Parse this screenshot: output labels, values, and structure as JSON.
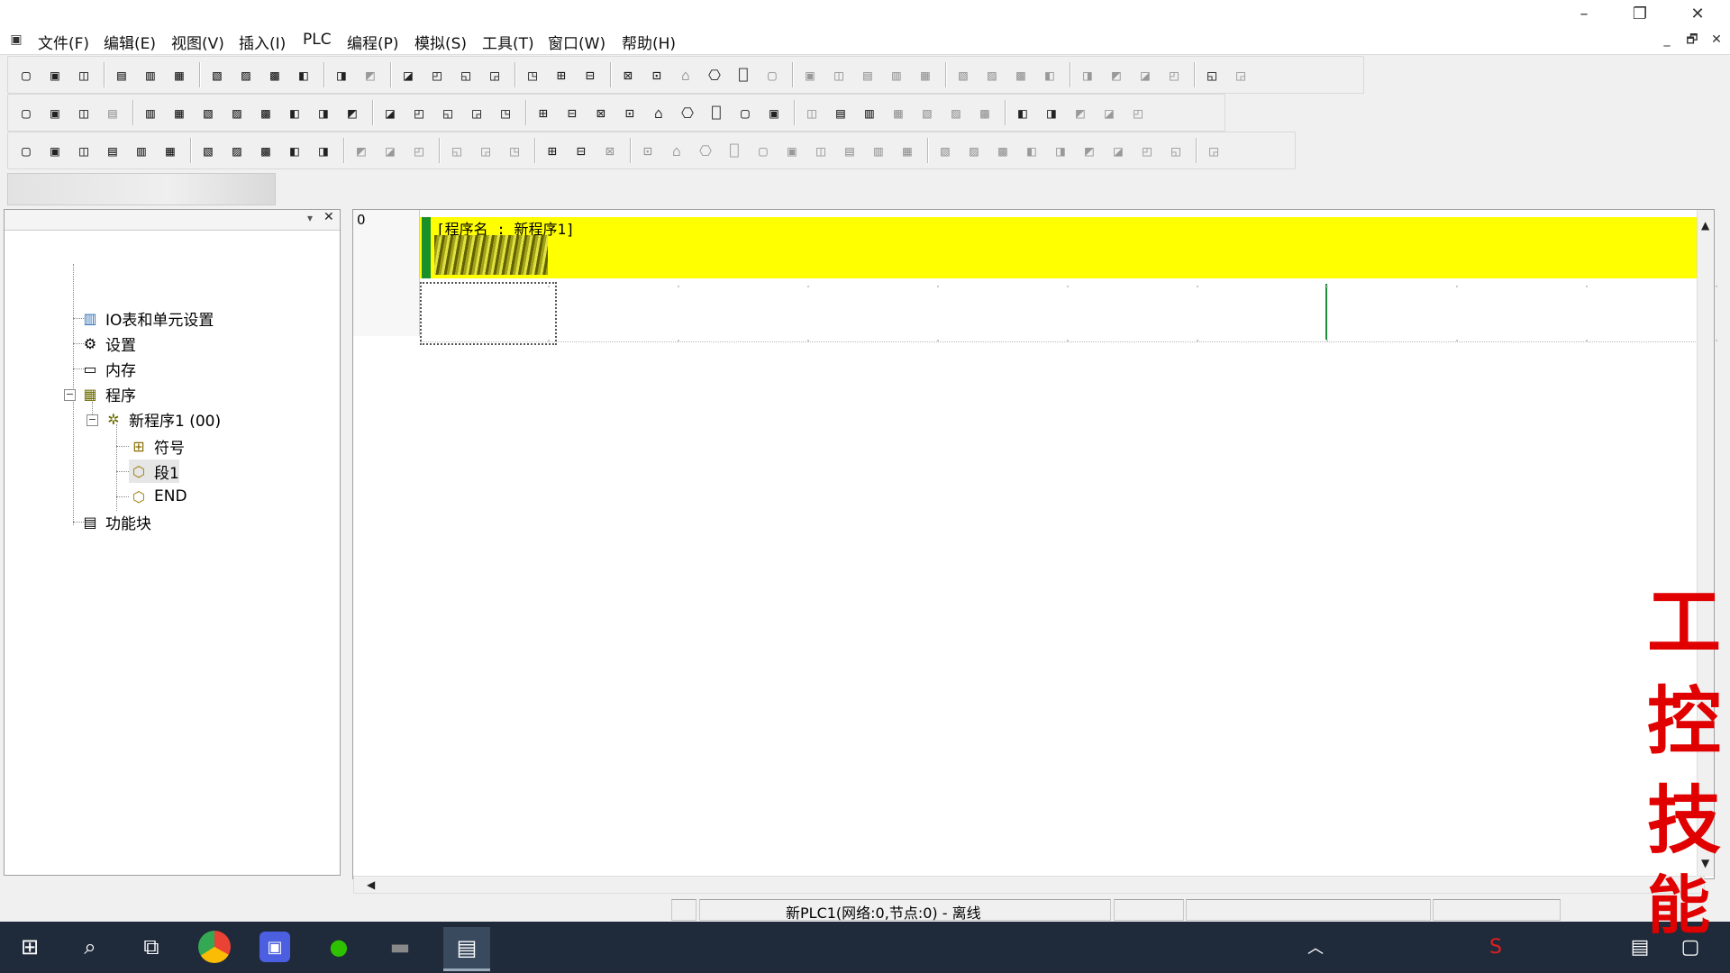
{
  "window": {
    "title": "",
    "controls": {
      "minimize": "–",
      "restore": "❐",
      "close": "✕"
    },
    "mdi_controls": {
      "minimize": "_",
      "restore": "🗗",
      "close": "✕"
    }
  },
  "menubar": {
    "items": [
      "文件(F)",
      "编辑(E)",
      "视图(V)",
      "插入(I)",
      "PLC",
      "编程(P)",
      "模拟(S)",
      "工具(T)",
      "窗口(W)",
      "帮助(H)"
    ]
  },
  "toolbar1": {
    "icons": [
      "new-icon",
      "open-icon",
      "save-icon",
      "print-preview-icon",
      "print-icon",
      "preview-icon",
      "cut-icon",
      "copy-icon",
      "paste-icon",
      "paste-special-icon",
      "undo-icon",
      "redo-icon",
      "find-icon",
      "replace-icon",
      "find-address-icon",
      "cross-ref-icon",
      "info-icon",
      "help-icon",
      "context-help-icon",
      "warning-icon",
      "compile-icon",
      "find-binoculars-icon",
      "program-check-icon",
      "monitor-icon",
      "online-edit-icon",
      "pause-icon",
      "transfer-icon",
      "transfer-to-icon",
      "transfer-from-icon",
      "compare-icon",
      "download-icon",
      "upload-icon",
      "memory-1-icon",
      "memory-2-icon",
      "memory-3-icon",
      "memory-4-icon",
      "force-on-icon",
      "force-off-icon",
      "io-table-icon",
      "setting-icon"
    ]
  },
  "toolbar2": {
    "icons": [
      "zoom-small-icon",
      "zoom-in-icon",
      "zoom-out-icon",
      "zoom-fit-icon",
      "grid-icon",
      "comment-icon",
      "list-icon",
      "rung-icon",
      "symbol-table-icon",
      "tree-icon",
      "memory-view-icon",
      "ct-icon",
      "select-icon",
      "contact-no-icon",
      "contact-nc-icon",
      "contact-or-icon",
      "contact-or-nc-icon",
      "vertical-line-icon",
      "horizontal-line-icon",
      "coil-icon",
      "coil-nc-icon",
      "instruction-icon",
      "instruction2-icon",
      "branch-icon",
      "corner-icon",
      "delete-icon",
      "network-icon",
      "stack-icon",
      "calendar-icon",
      "bit-icon",
      "bit2-icon",
      "bit3-icon",
      "bit4-icon",
      "table-icon",
      "grid-view-icon",
      "view1-icon",
      "view2-icon",
      "view3-icon"
    ]
  },
  "toolbar3": {
    "icons": [
      "window-icon",
      "window2-icon",
      "window3-icon",
      "window4-icon",
      "window5-icon",
      "properties-icon",
      "link-icon",
      "symbol-icon",
      "book-icon",
      "frame-icon",
      "calc-icon",
      "counter10-icon",
      "counter10b-icon",
      "counter16-icon",
      "step-in-icon",
      "step-out-icon",
      "sim-icon",
      "sim-online-icon",
      "sim-monitor-icon",
      "sim-list-icon",
      "hand-icon",
      "hand2-icon",
      "play-icon",
      "stop-icon",
      "pause2-icon",
      "step-forward-icon",
      "step-into-icon",
      "step-over-icon",
      "fast-forward-icon",
      "end-icon",
      "segment-icon",
      "segment2-icon",
      "segment3-icon",
      "segment4-icon",
      "divider1-icon",
      "divider2-icon",
      "divider3-icon",
      "divider4-icon",
      "divider5-icon",
      "return-icon"
    ]
  },
  "tree": {
    "items": [
      {
        "label": "IO表和单元设置",
        "icon": "io-table-icon",
        "level": 1
      },
      {
        "label": "设置",
        "icon": "settings-icon",
        "level": 1
      },
      {
        "label": "内存",
        "icon": "memory-icon",
        "level": 1
      },
      {
        "label": "程序",
        "icon": "program-icon",
        "level": 1,
        "expander": "−"
      },
      {
        "label": "新程序1 (00)",
        "icon": "program-node-icon",
        "level": 2,
        "expander": "−"
      },
      {
        "label": "符号",
        "icon": "symbol-icon",
        "level": 3
      },
      {
        "label": "段1",
        "icon": "segment-icon",
        "level": 3
      },
      {
        "label": "END",
        "icon": "end-segment-icon",
        "level": 3
      },
      {
        "label": "功能块",
        "icon": "function-block-icon",
        "level": 1
      }
    ]
  },
  "ladder": {
    "rung_number": "0",
    "program_title": "[程序名 : 新程序1]"
  },
  "status": {
    "text": "新PLC1(网络:0,节点:0) - 离线"
  },
  "taskbar": {
    "icons": [
      "windows-start-icon",
      "search-icon",
      "task-view-icon",
      "chrome-icon",
      "store-icon",
      "wechat-icon",
      "app-icon",
      "cx-programmer-icon"
    ]
  },
  "watermark": {
    "chars": [
      "工",
      "控",
      "技",
      "能"
    ]
  },
  "colors": {
    "title_band": "#ffff00",
    "rail_green": "#1b8c3a",
    "taskbar": "#1f2a3a",
    "watermark": "#e00000"
  }
}
